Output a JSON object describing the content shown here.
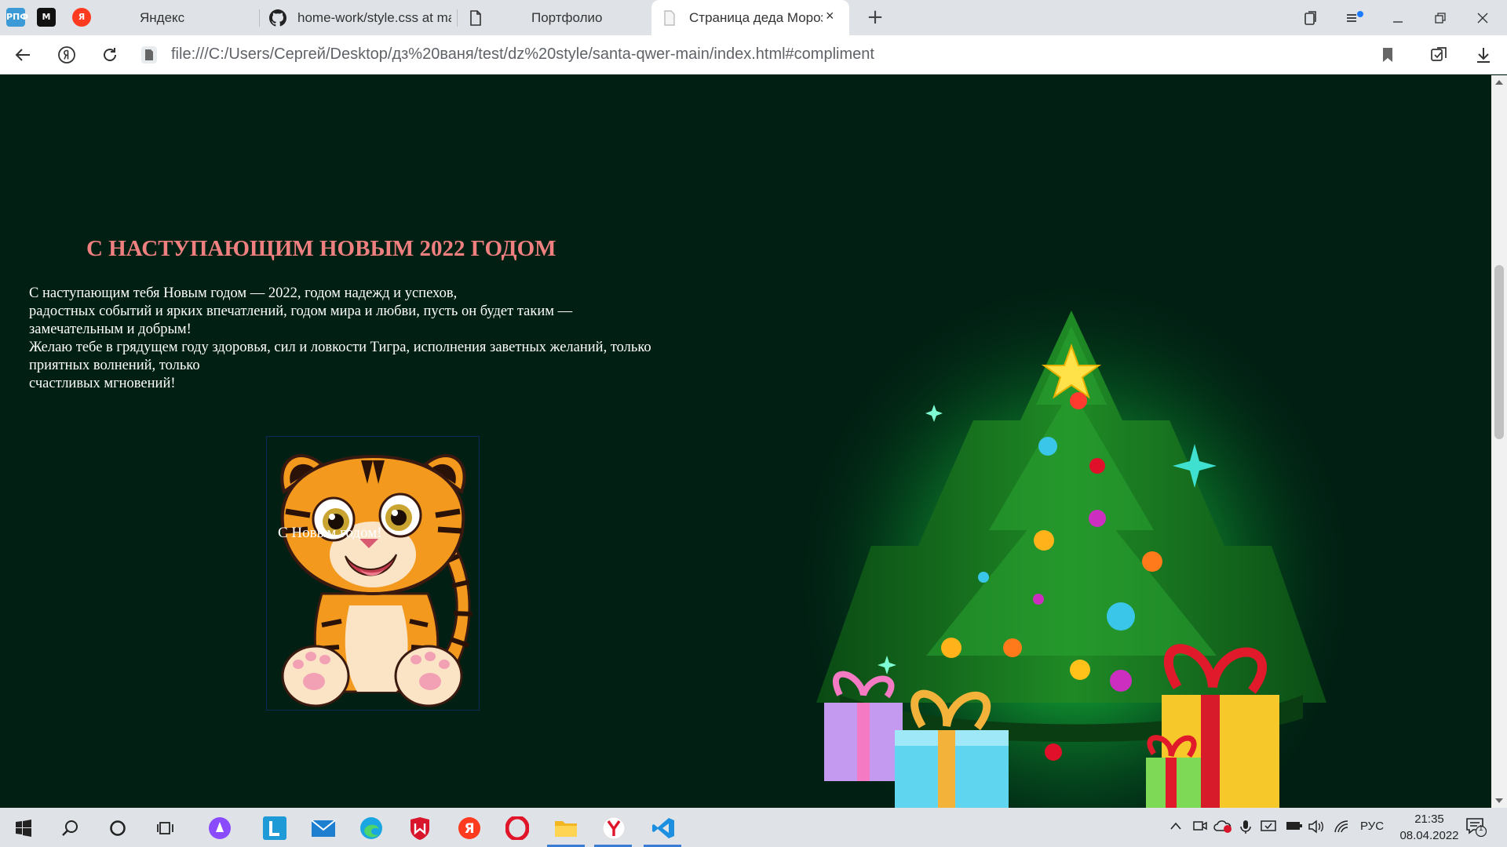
{
  "browser": {
    "tabs": [
      {
        "label": "Яндекс",
        "icon": "yandex-icon"
      },
      {
        "label": "home-work/style.css at ma",
        "icon": "github-icon"
      },
      {
        "label": "Портфолио",
        "icon": "file-icon"
      },
      {
        "label": "Страница деда Мороза",
        "icon": "page-icon",
        "active": true
      }
    ],
    "pinned": [
      {
        "label": "РПФ",
        "color": "#3c9bd6"
      },
      {
        "label": "M",
        "color": "#111111"
      },
      {
        "label": "Я",
        "color": "#ff3b1f"
      }
    ],
    "new_tab": "+",
    "close_tab": "×",
    "address": "file:///C:/Users/Сергей/Desktop/дз%20ваня/test/dz%20style/santa-qwer-main/index.html#compliment"
  },
  "page": {
    "heading": "С НАСТУПАЮЩИМ НОВЫМ 2022 ГОДОМ",
    "wish_lines": [
      "С наступающим тебя Новым годом — 2022, годом надежд и успехов,",
      "радостных событий и ярких впечатлений, годом мира и любви, пусть он будет таким —",
      "замечательным и добрым!",
      "Желаю тебе в грядущем году здоровья, сил и ловкости Тигра, исполнения заветных желаний, только",
      "приятных волнений, только",
      "счастливых мгновений!"
    ],
    "tiger_caption": "С Новым годом!",
    "colors": {
      "background": "#012013",
      "heading": "#f08080",
      "text": "#ffffff"
    }
  },
  "taskbar": {
    "language": "РУС",
    "time": "21:35",
    "date": "08.04.2022",
    "notifications": "1"
  }
}
